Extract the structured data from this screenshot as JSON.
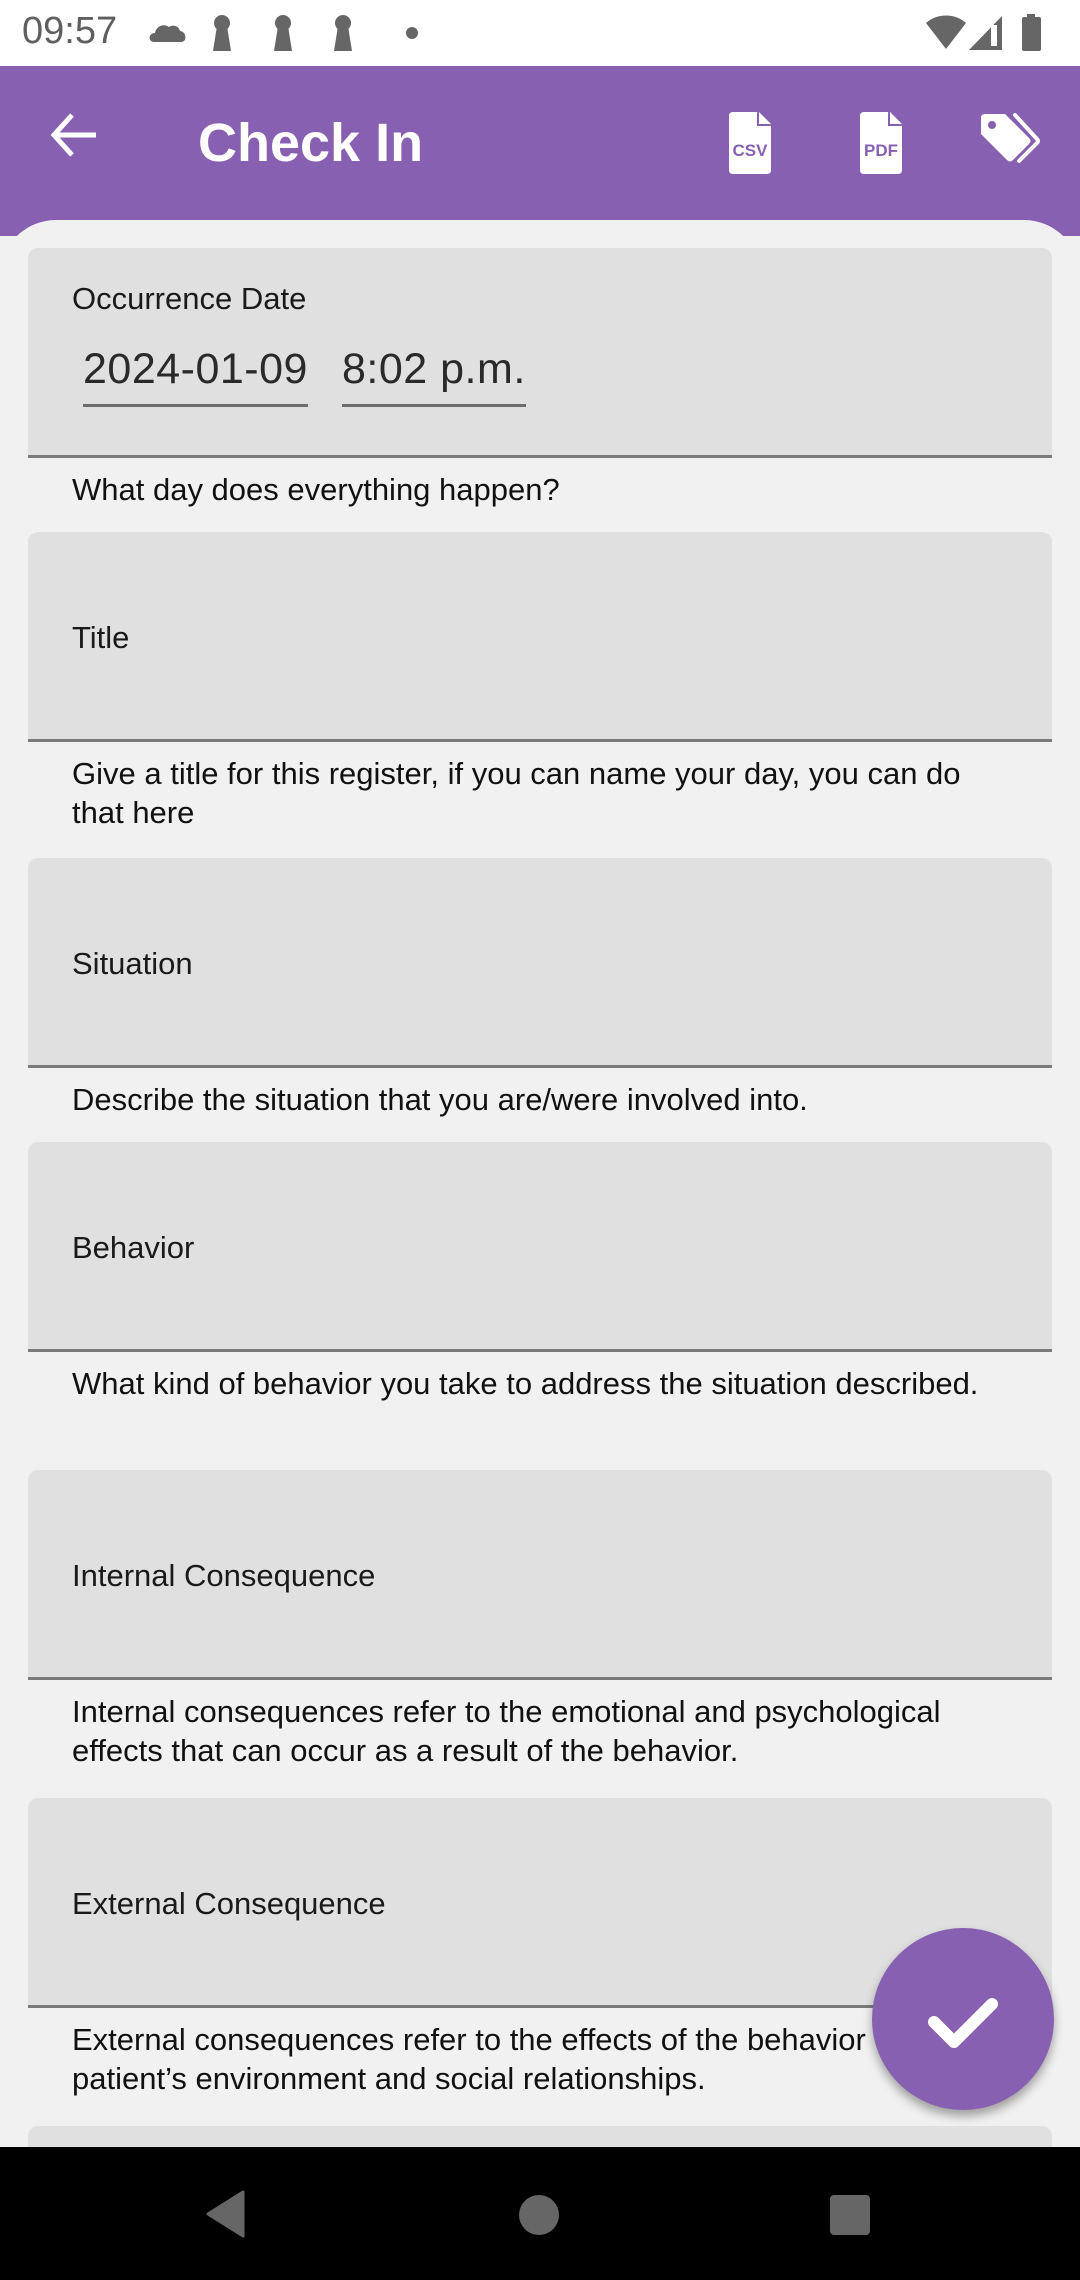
{
  "status_bar": {
    "time": "09:57",
    "left_icons": [
      "cloud-icon",
      "keyhole-icon",
      "keyhole-icon",
      "keyhole-icon",
      "dot-icon"
    ],
    "right_icons": [
      "wifi-icon",
      "cellular-signal-icon",
      "battery-icon"
    ]
  },
  "app_bar": {
    "title": "Check In",
    "back_icon": "arrow-left-icon",
    "actions": [
      {
        "name": "export-csv",
        "icon": "csv-file-icon",
        "glyph": "CSV"
      },
      {
        "name": "export-pdf",
        "icon": "pdf-file-icon",
        "glyph": "PDF"
      },
      {
        "name": "tags",
        "icon": "tags-icon"
      }
    ]
  },
  "form": {
    "occurrence": {
      "label": "Occurrence Date",
      "date": "2024-01-09",
      "time": "8:02 p.m.",
      "helper": "What day does everything happen?"
    },
    "fields": [
      {
        "label": "Title",
        "value": "",
        "helper": "Give a title for this register, if you can name your day, you can do that here"
      },
      {
        "label": "Situation",
        "value": "",
        "helper": "Describe the situation that you are/were involved into."
      },
      {
        "label": "Behavior",
        "value": "",
        "helper": "What kind of behavior you take to address the situation described."
      },
      {
        "label": "Internal Consequence",
        "value": "",
        "helper": "Internal consequences refer to the emotional and psychological effects that can occur as a result of the behavior."
      },
      {
        "label": "External Consequence",
        "value": "",
        "helper": "External consequences refer to the effects of the behavior on the patient’s environment and social relationships."
      }
    ]
  },
  "fab": {
    "icon": "check-icon",
    "action": "save"
  },
  "nav_bar": {
    "buttons": [
      "back-triangle-icon",
      "home-circle-icon",
      "recents-square-icon"
    ]
  },
  "colors": {
    "primary": "#8860b1",
    "field_bg": "#e0e0e0",
    "page_bg": "#f1f1f1"
  }
}
